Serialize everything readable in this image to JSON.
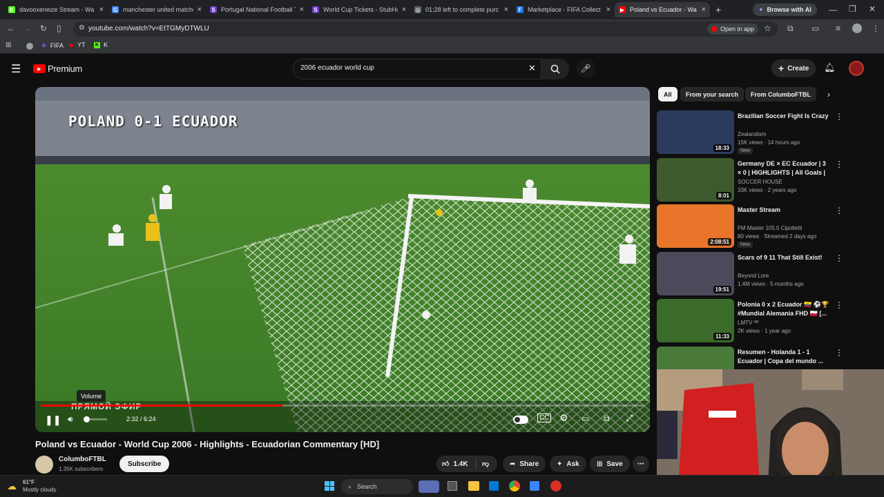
{
  "browser": {
    "tabs": [
      {
        "title": "davooxeneize Stream - Wa",
        "fav": "K",
        "fav_color": "#53fc18"
      },
      {
        "title": "manchester united matches",
        "fav": "G",
        "fav_color": "#4285f4"
      },
      {
        "title": "Portugal National Football T",
        "fav": "S",
        "fav_color": "#6a3bc9"
      },
      {
        "title": "World Cup Tickets - StubHu",
        "fav": "S",
        "fav_color": "#6a3bc9"
      },
      {
        "title": "01:28 left to complete purc",
        "fav": "◎",
        "fav_color": "#5f6368"
      },
      {
        "title": "Marketplace - FIFA Collect",
        "fav": "F",
        "fav_color": "#1a73e8"
      },
      {
        "title": "Poland vs Ecuador - Wa",
        "fav": "▶",
        "fav_color": "#ff0000"
      }
    ],
    "new_tab": "+",
    "browse_ai": "Browse with AI",
    "url": "youtube.com/watch?v=EtTGMyDTWLU",
    "open_in_app": "Open in app",
    "bookmarks": [
      {
        "label": "FIFA"
      },
      {
        "label": "YT"
      },
      {
        "label": "K"
      }
    ]
  },
  "youtube": {
    "logo_text": "Premium",
    "search_value": "2006 ecuador world cup",
    "create_label": "Create",
    "video": {
      "overlay_title": "POLAND 0-1 ECUADOR",
      "overlay_sub": "ПРЯМОЙ ЭФИР",
      "time": "2:32 / 6:24",
      "progress": 0.4,
      "volume_tooltip": "Volume",
      "title": "Poland vs Ecuador - World Cup 2006 - Highlights - Ecuadorian Commentary [HD]"
    },
    "channel": {
      "name": "ColumboFTBL",
      "subs": "1.35K subscribers",
      "subscribe": "Subscribe"
    },
    "actions": {
      "likes": "1.4K",
      "share": "Share",
      "ask": "Ask",
      "save": "Save"
    },
    "chips": [
      "All",
      "From your search",
      "From ColumboFTBL"
    ],
    "recommendations": [
      {
        "title": "Brazilian Soccer Fight Is Crazy",
        "channel": "Zealandism",
        "meta": "15K views · 14 hours ago",
        "badge": "New",
        "duration": "18:33",
        "color": "#2a3b5e"
      },
      {
        "title": "Germany DE × EC Ecuador | 3 × 0 | HIGHLIGHTS | All Goals | Wor...",
        "channel": "SOCCER HOUSE",
        "meta": "33K views · 2 years ago",
        "badge": "",
        "duration": "8:01",
        "color": "#3d5a2e"
      },
      {
        "title": "Master Stream",
        "channel": "FM Master 105.5 Cipolletti",
        "meta": "80 views · Streamed 2 days ago",
        "badge": "New",
        "duration": "2:08:51",
        "color": "#e8752a"
      },
      {
        "title": "Scars of 9 11 That Still Exist!",
        "channel": "Beyond Lore",
        "meta": "1.4M views · 5 months ago",
        "badge": "",
        "duration": "19:51",
        "color": "#4a4a5a"
      },
      {
        "title": "Polonia 0 x 2 Ecuador 🇪🇨 ⚽🏆 #Mundial Alemania FHD 🇵🇱 [...",
        "channel": "LMTV ᴴᴰ",
        "meta": "2K views · 1 year ago",
        "badge": "",
        "duration": "11:33",
        "color": "#3b6b2a"
      },
      {
        "title": "Resumen - Holanda 1 - 1 Ecuador | Copa del mundo ...",
        "channel": "",
        "meta": "",
        "badge": "",
        "duration": "",
        "color": "#4a7a3a"
      }
    ]
  },
  "taskbar": {
    "temp": "61°F",
    "weather": "Mostly cloudy",
    "search": "Search"
  }
}
